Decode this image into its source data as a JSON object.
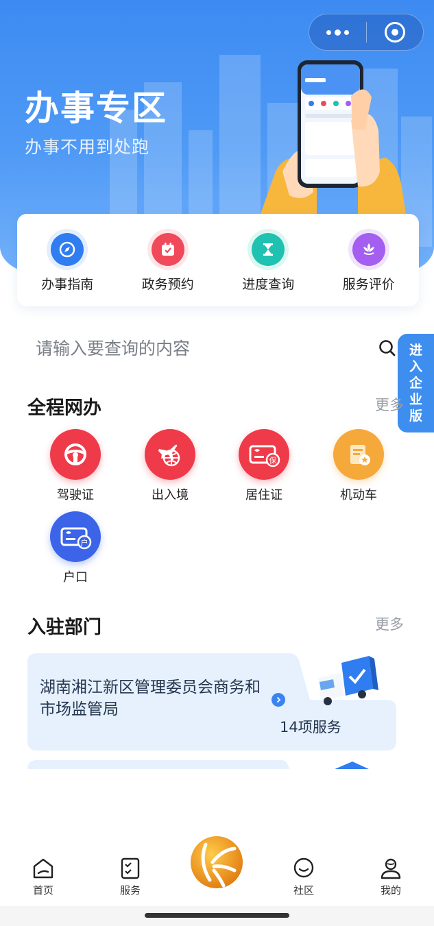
{
  "header": {
    "title": "办事专区",
    "subtitle": "办事不用到处跑",
    "capsule": {
      "more_icon": "more-dots-icon",
      "close_icon": "target-close-icon"
    }
  },
  "quick_actions": [
    {
      "label": "办事指南",
      "icon": "compass-icon",
      "color": "#2f7df0"
    },
    {
      "label": "政务预约",
      "icon": "calendar-check-icon",
      "color": "#f04a5a"
    },
    {
      "label": "进度查询",
      "icon": "hourglass-icon",
      "color": "#1fc2b0"
    },
    {
      "label": "服务评价",
      "icon": "flower-icon",
      "color": "#a45ef0"
    }
  ],
  "search": {
    "placeholder": "请输入要查询的内容",
    "icon": "search-icon"
  },
  "enterprise_tab": {
    "label_chars": [
      "进",
      "入",
      "企",
      "业",
      "版"
    ]
  },
  "online_section": {
    "title": "全程网办",
    "more": "更多",
    "items": [
      {
        "label": "驾驶证",
        "icon": "steering-wheel-icon",
        "color": "#ef3a4a"
      },
      {
        "label": "出入境",
        "icon": "plane-globe-icon",
        "color": "#ef3a4a"
      },
      {
        "label": "居住证",
        "icon": "residence-card-icon",
        "color": "#ef3a4a",
        "badge": "保"
      },
      {
        "label": "机动车",
        "icon": "vehicle-doc-icon",
        "color": "#f6a93b"
      },
      {
        "label": "户口",
        "icon": "household-card-icon",
        "color": "#3b64e8",
        "badge": "户"
      }
    ]
  },
  "dept_section": {
    "title": "入驻部门",
    "more": "更多",
    "departments": [
      {
        "name": "湖南湘江新区管理委员会商务和市场监管局",
        "count": "14项服务"
      }
    ]
  },
  "tabbar": [
    {
      "label": "首页",
      "icon": "home-icon"
    },
    {
      "label": "服务",
      "icon": "checklist-icon"
    },
    {
      "label": "",
      "icon": "app-logo-icon"
    },
    {
      "label": "社区",
      "icon": "chat-smile-icon"
    },
    {
      "label": "我的",
      "icon": "user-icon"
    }
  ],
  "colors": {
    "primary": "#3e8ef0",
    "hero_top": "#3d8bf2"
  }
}
